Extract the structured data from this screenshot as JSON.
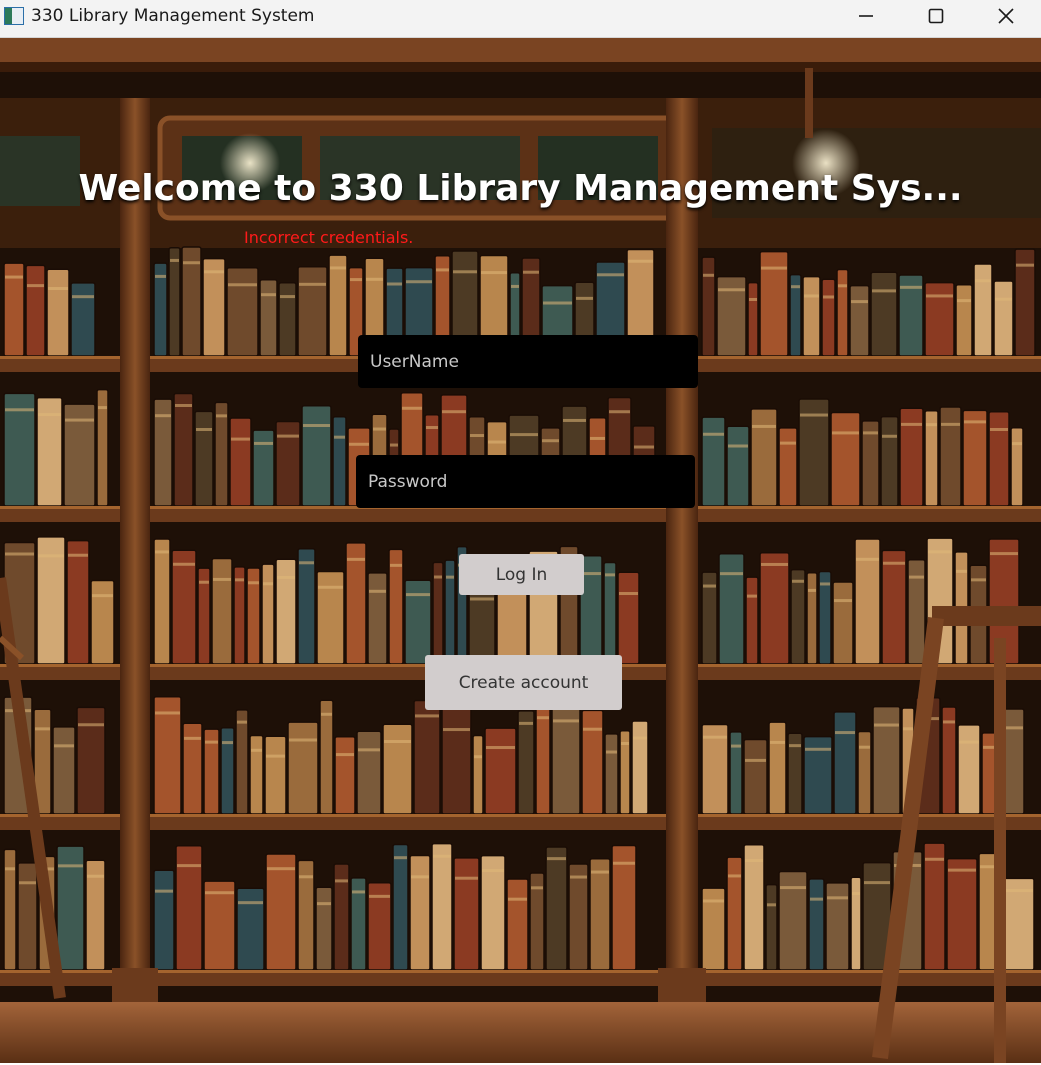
{
  "window": {
    "title": "330 Library Management System",
    "icons": {
      "app": "app-window-icon",
      "minimize": "minimize-icon",
      "maximize": "maximize-icon",
      "close": "close-icon"
    }
  },
  "login": {
    "heading": "Welcome to 330 Library Management Sys...",
    "error_message": "Incorrect credentials.",
    "username_placeholder": "UserName",
    "username_value": "",
    "password_placeholder": "Password",
    "password_value": "",
    "login_label": "Log In",
    "create_account_label": "Create account"
  },
  "colors": {
    "error": "#ff1a1a",
    "field_bg": "#000000",
    "button_bg": "#d2cdcd",
    "shelf_wood": "#6b3a1c"
  }
}
